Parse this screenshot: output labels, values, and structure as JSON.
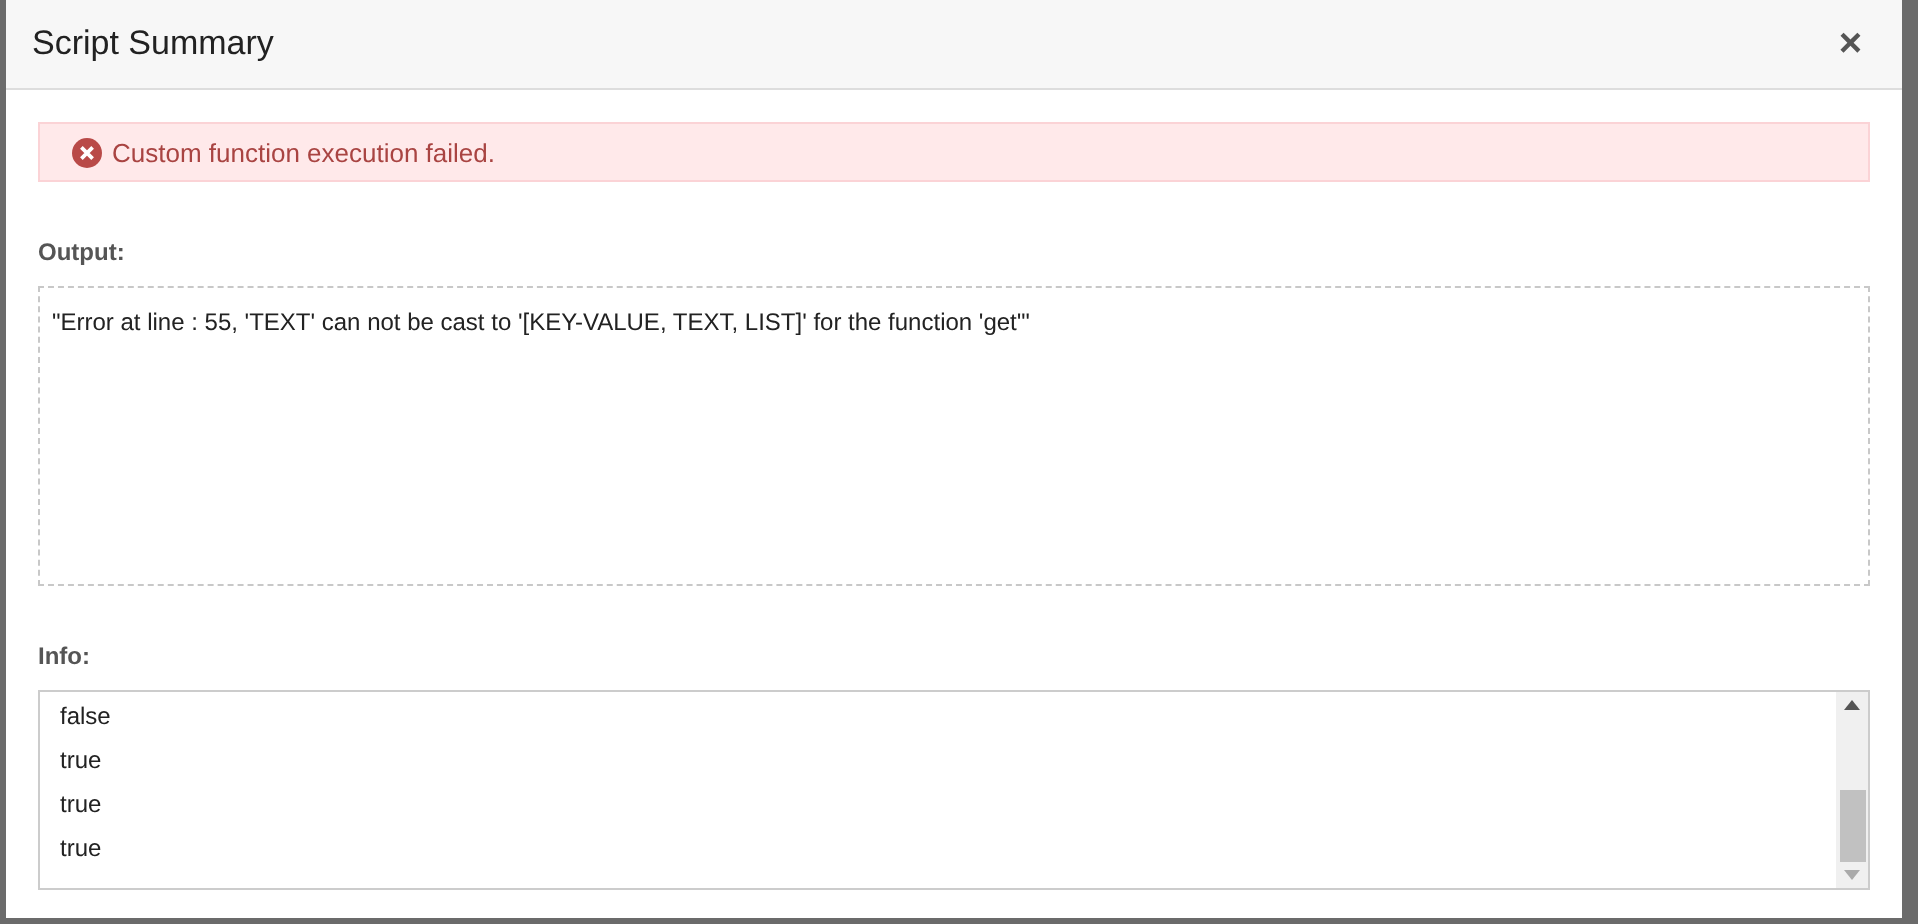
{
  "dialog": {
    "title": "Script Summary",
    "close": "×"
  },
  "alert": {
    "kind": "error",
    "message": "Custom function execution failed."
  },
  "output": {
    "label": "Output:",
    "text": "\"Error at line : 55, 'TEXT' can not be cast to '[KEY-VALUE, TEXT, LIST]' for the function 'get'\""
  },
  "info": {
    "label": "Info:",
    "lines": [
      "false",
      "true",
      "true",
      "true"
    ]
  }
}
